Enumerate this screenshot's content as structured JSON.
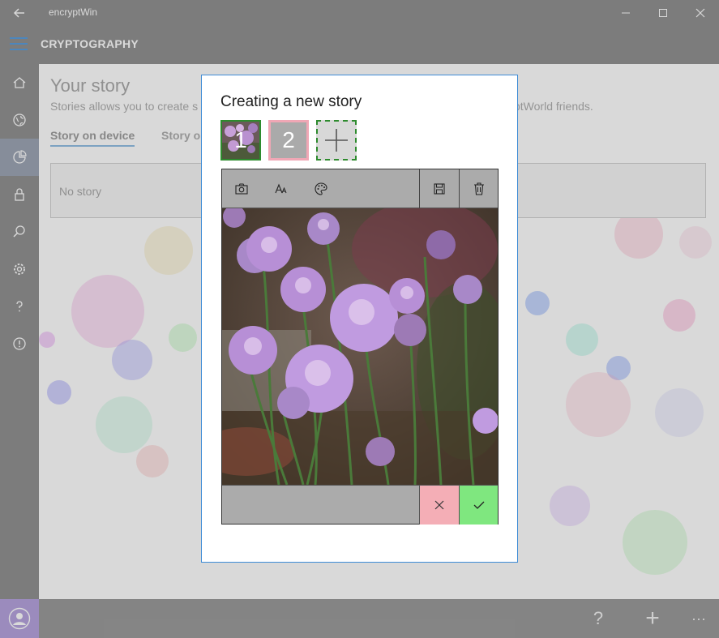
{
  "window": {
    "title": "encryptWin"
  },
  "app": {
    "title": "CRYPTOGRAPHY"
  },
  "rail": {
    "items": [
      {
        "icon": "home-icon"
      },
      {
        "icon": "globe-icon"
      },
      {
        "icon": "story-icon",
        "active": true
      },
      {
        "icon": "lock-icon"
      },
      {
        "icon": "search-icon"
      },
      {
        "icon": "gear-icon"
      },
      {
        "icon": "help-icon"
      },
      {
        "icon": "info-icon"
      }
    ]
  },
  "page": {
    "title": "Your story",
    "subtitle_left": "Stories allows you to create s",
    "subtitle_right": "ptWorld friends.",
    "tabs": [
      {
        "label": "Story on device",
        "active": true
      },
      {
        "label": "Story o"
      }
    ],
    "empty_text": "No story"
  },
  "dialog": {
    "title": "Creating a new story",
    "slides": [
      {
        "number": "1",
        "selected": true
      },
      {
        "number": "2"
      }
    ],
    "toolbar": {
      "tools": [
        "camera-icon",
        "text-size-icon",
        "palette-icon"
      ],
      "actions": [
        "save-icon",
        "delete-icon"
      ]
    }
  },
  "bottombar": {
    "help_label": "?",
    "add_label": "+",
    "more_label": "···"
  },
  "colors": {
    "accent": "#3d8bd6",
    "selected_slide": "#2e8b2e",
    "cancel": "#f4aeb6",
    "confirm": "#7fe77f",
    "chrome": "#7f7f7f"
  }
}
